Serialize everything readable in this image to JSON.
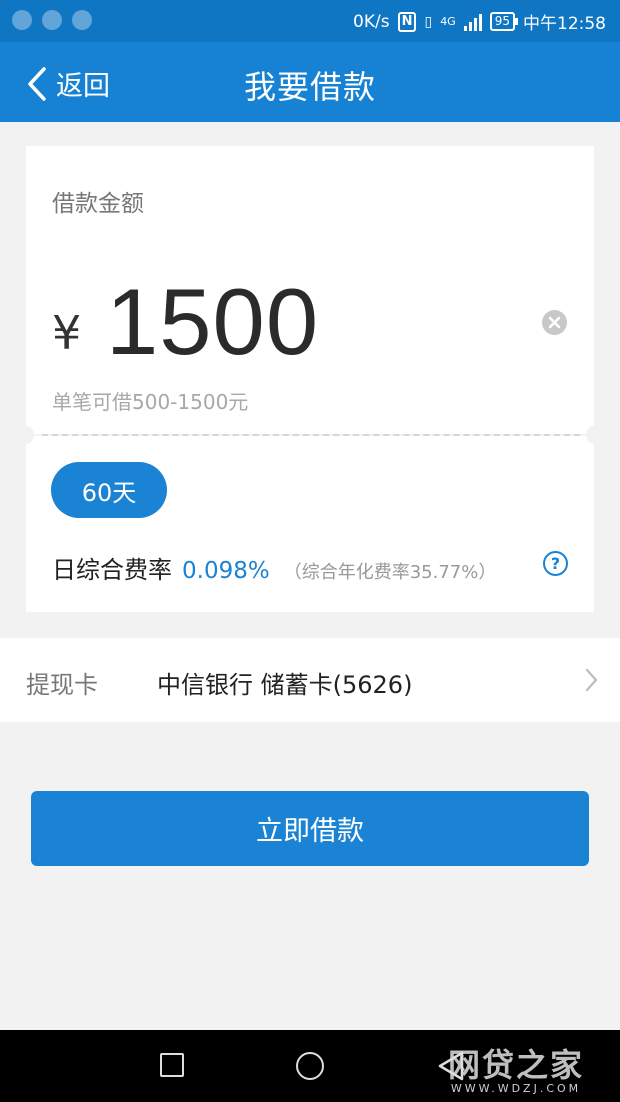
{
  "status_bar": {
    "net_speed": "0K/s",
    "nfc": "N",
    "network_type": "4G",
    "battery": "95",
    "time": "中午12:58"
  },
  "nav": {
    "back_label": "返回",
    "title": "我要借款"
  },
  "loan": {
    "amount_label": "借款金额",
    "currency": "¥",
    "amount": "1500",
    "range_hint": "单笔可借500-1500元",
    "term": "60天",
    "rate_label": "日综合费率",
    "rate_value": "0.098%",
    "annual_rate": "（综合年化费率35.77%）"
  },
  "withdraw_card": {
    "label": "提现卡",
    "value": "中信银行 储蓄卡(5626)"
  },
  "submit_label": "立即借款",
  "watermark": {
    "main": "网贷之家",
    "sub": "WWW.WDZJ.COM"
  },
  "colors": {
    "accent": "#1a83d4",
    "status_bar": "#0f76c4",
    "nav_bar": "#1782d3",
    "background": "#f2f2f2"
  }
}
